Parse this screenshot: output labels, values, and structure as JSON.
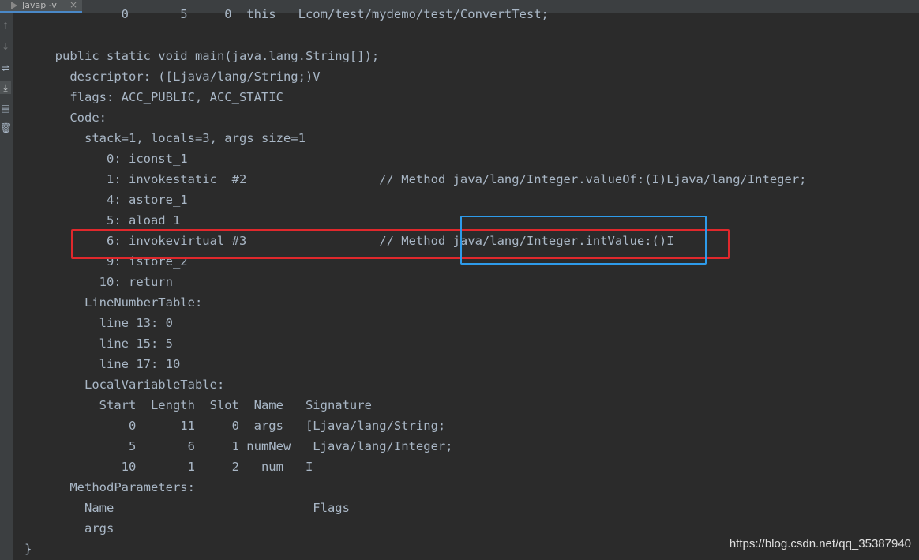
{
  "tab": {
    "label": "Javap -v",
    "close": "×",
    "icon": "run-triangle-icon"
  },
  "gutter": {
    "icons": [
      {
        "name": "scroll-up-icon",
        "glyph": "↑"
      },
      {
        "name": "scroll-down-icon",
        "glyph": "↓"
      },
      {
        "name": "soft-wrap-icon",
        "glyph": "⇌"
      },
      {
        "name": "scroll-to-end-icon",
        "glyph": "⤓"
      },
      {
        "name": "print-icon",
        "glyph": "▤"
      },
      {
        "name": "trash-icon",
        "glyph": "🗑"
      }
    ]
  },
  "lines": [
    "           0       5     0  this   Lcom/test/mydemo/test/ConvertTest;",
    "",
    "  public static void main(java.lang.String[]);",
    "    descriptor: ([Ljava/lang/String;)V",
    "    flags: ACC_PUBLIC, ACC_STATIC",
    "    Code:",
    "      stack=1, locals=3, args_size=1",
    "         0: iconst_1",
    "         1: invokestatic  #2                  // Method java/lang/Integer.valueOf:(I)Ljava/lang/Integer;",
    "         4: astore_1",
    "         5: aload_1",
    "         6: invokevirtual #3                  // Method java/lang/Integer.intValue:()I",
    "         9: istore_2",
    "        10: return",
    "      LineNumberTable:",
    "        line 13: 0",
    "        line 15: 5",
    "        line 17: 10",
    "      LocalVariableTable:",
    "        Start  Length  Slot  Name   Signature",
    "            0      11     0  args   [Ljava/lang/String;",
    "            5       6     1 numNew   Ljava/lang/Integer;",
    "           10       1     2   num   I",
    "    MethodParameters:",
    "      Name                           Flags",
    "      args",
    "}"
  ],
  "colors": {
    "background": "#2b2b2b",
    "text": "#a9b7c6",
    "highlight_red": "#e0282c",
    "highlight_blue": "#2e9bea"
  },
  "watermark": "https://blog.csdn.net/qq_35387940"
}
